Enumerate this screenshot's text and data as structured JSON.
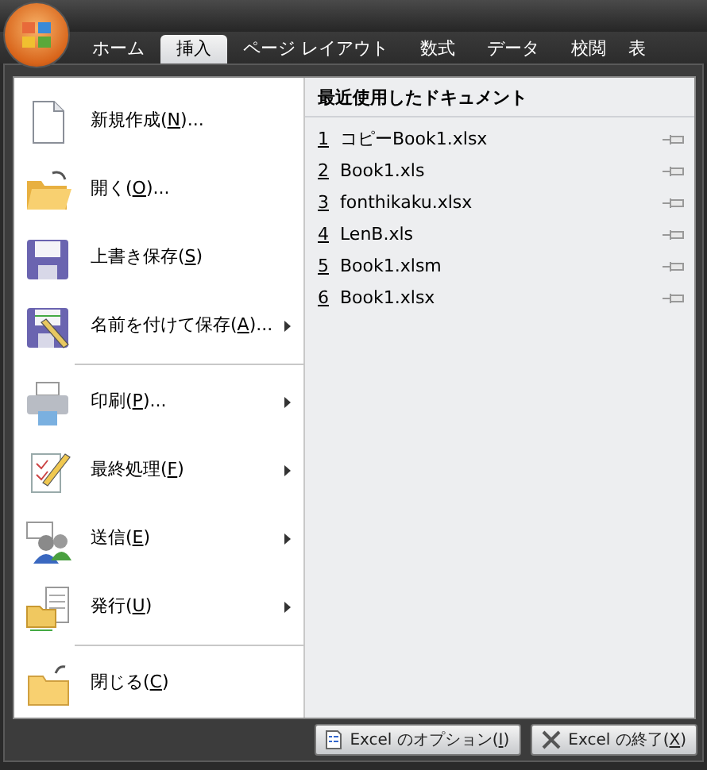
{
  "tabs": [
    {
      "label": "ホーム",
      "selected": false
    },
    {
      "label": "挿入",
      "selected": true
    },
    {
      "label": "ページ レイアウト",
      "selected": false
    },
    {
      "label": "数式",
      "selected": false
    },
    {
      "label": "データ",
      "selected": false
    },
    {
      "label": "校閲",
      "selected": false
    },
    {
      "label": "表",
      "selected": false
    }
  ],
  "menu": {
    "items": [
      {
        "kind": "new",
        "before": "新規作成(",
        "key": "N",
        "after": ")...",
        "submenu": false,
        "separator_before": false
      },
      {
        "kind": "open",
        "before": "開く(",
        "key": "O",
        "after": ")...",
        "submenu": false,
        "separator_before": false
      },
      {
        "kind": "save",
        "before": "上書き保存(",
        "key": "S",
        "after": ")",
        "submenu": false,
        "separator_before": false
      },
      {
        "kind": "saveas",
        "before": "名前を付けて保存(",
        "key": "A",
        "after": ")...",
        "submenu": true,
        "separator_before": false
      },
      {
        "kind": "print",
        "before": "印刷(",
        "key": "P",
        "after": ")...",
        "submenu": true,
        "separator_before": true
      },
      {
        "kind": "finish",
        "before": "最終処理(",
        "key": "F",
        "after": ")",
        "submenu": true,
        "separator_before": false
      },
      {
        "kind": "send",
        "before": "送信(",
        "key": "E",
        "after": ")",
        "submenu": true,
        "separator_before": false
      },
      {
        "kind": "publish",
        "before": "発行(",
        "key": "U",
        "after": ")",
        "submenu": true,
        "separator_before": false
      },
      {
        "kind": "close",
        "before": "閉じる(",
        "key": "C",
        "after": ")",
        "submenu": false,
        "separator_before": true
      }
    ]
  },
  "recent": {
    "title": "最近使用したドキュメント",
    "documents": [
      {
        "number": "1",
        "name": "コピーBook1.xlsx"
      },
      {
        "number": "2",
        "name": "Book1.xls"
      },
      {
        "number": "3",
        "name": "fonthikaku.xlsx"
      },
      {
        "number": "4",
        "name": "LenB.xls"
      },
      {
        "number": "5",
        "name": "Book1.xlsm"
      },
      {
        "number": "6",
        "name": "Book1.xlsx"
      }
    ]
  },
  "footer": {
    "buttons": [
      {
        "kind": "options",
        "before": "Excel のオプション(",
        "key": "I",
        "after": ")"
      },
      {
        "kind": "exit",
        "before": "Excel の終了(",
        "key": "X",
        "after": ")"
      }
    ]
  }
}
